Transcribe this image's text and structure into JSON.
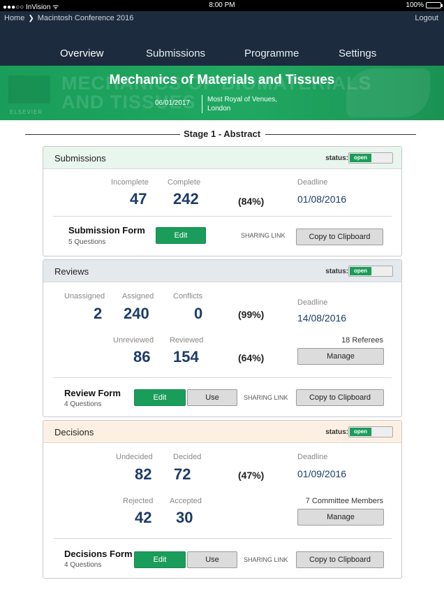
{
  "statusbar": {
    "carrier": "●●●○○ InVision ᯤ",
    "time": "8:00 PM",
    "battery": "100%"
  },
  "breadcrumb": {
    "home": "Home",
    "separator": "❯",
    "conference": "Macintosh Conference 2016",
    "logout": "Logout"
  },
  "nav": {
    "tabs": [
      "Overview",
      "Submissions",
      "Programme",
      "Settings"
    ],
    "active": "Overview"
  },
  "banner": {
    "title": "Mechanics of Materials and Tissues",
    "date": "06/01/2017",
    "venue": "Most Royal of Venues, London"
  },
  "stage": {
    "label": "Stage 1 - Abstract"
  },
  "submissions": {
    "title": "Submissions",
    "status_label": "status:",
    "status_value": "open",
    "incomplete_label": "Incomplete",
    "incomplete": "47",
    "complete_label": "Complete",
    "complete": "242",
    "percent": "(84%)",
    "deadline_label": "Deadline",
    "deadline": "01/08/2016",
    "form_name": "Submission Form",
    "form_questions": "5 Questions",
    "edit": "Edit",
    "sharing_link": "SHARING LINK",
    "copy": "Copy to Clipboard"
  },
  "reviews": {
    "title": "Reviews",
    "status_label": "status:",
    "status_value": "open",
    "unassigned_label": "Unassigned",
    "unassigned": "2",
    "assigned_label": "Assigned",
    "assigned": "240",
    "conflicts_label": "Conflicts",
    "conflicts": "0",
    "percent_assigned": "(99%)",
    "deadline_label": "Deadline",
    "deadline": "14/08/2016",
    "unreviewed_label": "Unreviewed",
    "unreviewed": "86",
    "reviewed_label": "Reviewed",
    "reviewed": "154",
    "percent_reviewed": "(64%)",
    "referees": "18 Referees",
    "manage": "Manage",
    "form_name": "Review Form",
    "form_questions": "4 Questions",
    "edit": "Edit",
    "use": "Use",
    "sharing_link": "SHARING LINK",
    "copy": "Copy to Clipboard"
  },
  "decisions": {
    "title": "Decisions",
    "status_label": "status:",
    "status_value": "open",
    "undecided_label": "Undecided",
    "undecided": "82",
    "decided_label": "Decided",
    "decided": "72",
    "percent_decided": "(47%)",
    "deadline_label": "Deadline",
    "deadline": "01/09/2016",
    "rejected_label": "Rejected",
    "rejected": "42",
    "accepted_label": "Accepted",
    "accepted": "30",
    "committee": "7 Committee Members",
    "manage": "Manage",
    "form_name": "Decisions Form",
    "form_questions": "4 Questions",
    "edit": "Edit",
    "use": "Use",
    "sharing_link": "SHARING LINK",
    "copy": "Copy to Clipboard"
  },
  "colors": {
    "nav_bg": "#1c2b3d",
    "banner_green": "#1a9d5a",
    "number_blue": "#1c3b6a",
    "submissions_head": "#e8f6ee",
    "reviews_head": "#e4e9ee",
    "decisions_head": "#fdf0e2",
    "active_underline": "#3f8fd6"
  }
}
